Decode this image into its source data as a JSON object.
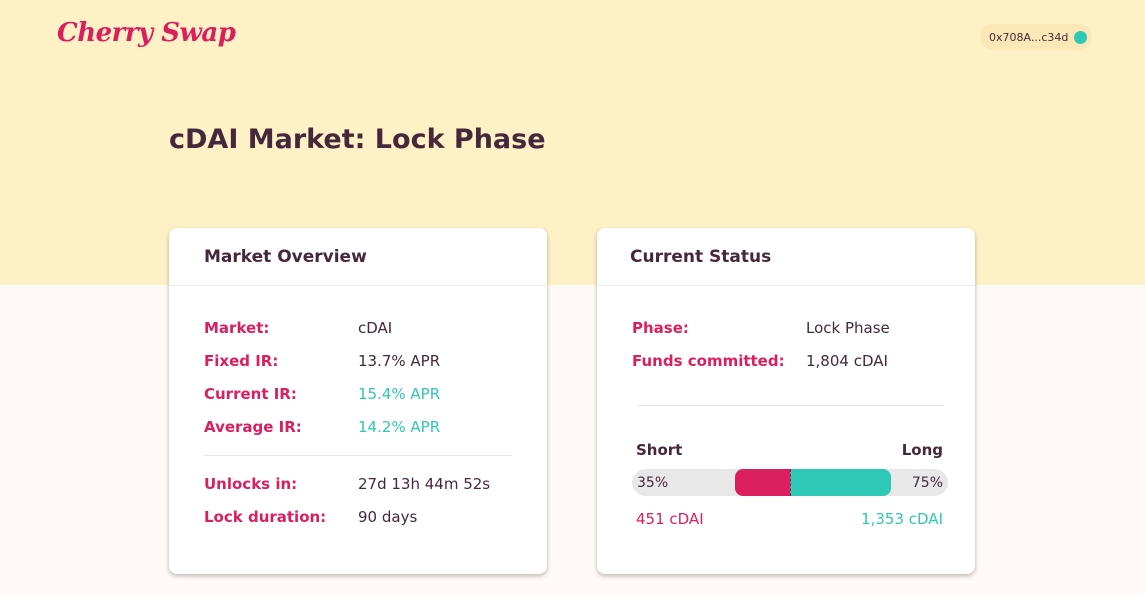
{
  "header": {
    "logo": "Cherry Swap",
    "wallet_address": "0x708A...c34d",
    "wallet_status_color": "#2fc7b6"
  },
  "page": {
    "title": "cDAI Market: Lock Phase"
  },
  "colors": {
    "accent": "#db1f5e",
    "teal": "#2fc7b6",
    "hero_bg": "#fff1c6",
    "text": "#45283c"
  },
  "market_overview": {
    "title": "Market Overview",
    "rows": [
      {
        "label": "Market:",
        "value": "cDAI"
      },
      {
        "label": "Fixed IR:",
        "value": "13.7% APR"
      },
      {
        "label": "Current IR:",
        "value": "15.4% APR"
      },
      {
        "label": "Average IR:",
        "value": "14.2% APR"
      }
    ],
    "timing": [
      {
        "label": "Unlocks in:",
        "value": "27d 13h 44m 52s"
      },
      {
        "label": "Lock duration:",
        "value": "90 days"
      }
    ]
  },
  "current_status": {
    "title": "Current Status",
    "rows": [
      {
        "label": "Phase:",
        "value": "Lock Phase"
      },
      {
        "label": "Funds committed:",
        "value": "1,804 cDAI"
      }
    ],
    "short_label": "Short",
    "long_label": "Long",
    "short_pct": "35%",
    "long_pct": "75%",
    "short_amount": "451 cDAI",
    "long_amount": "1,353 cDAI"
  }
}
